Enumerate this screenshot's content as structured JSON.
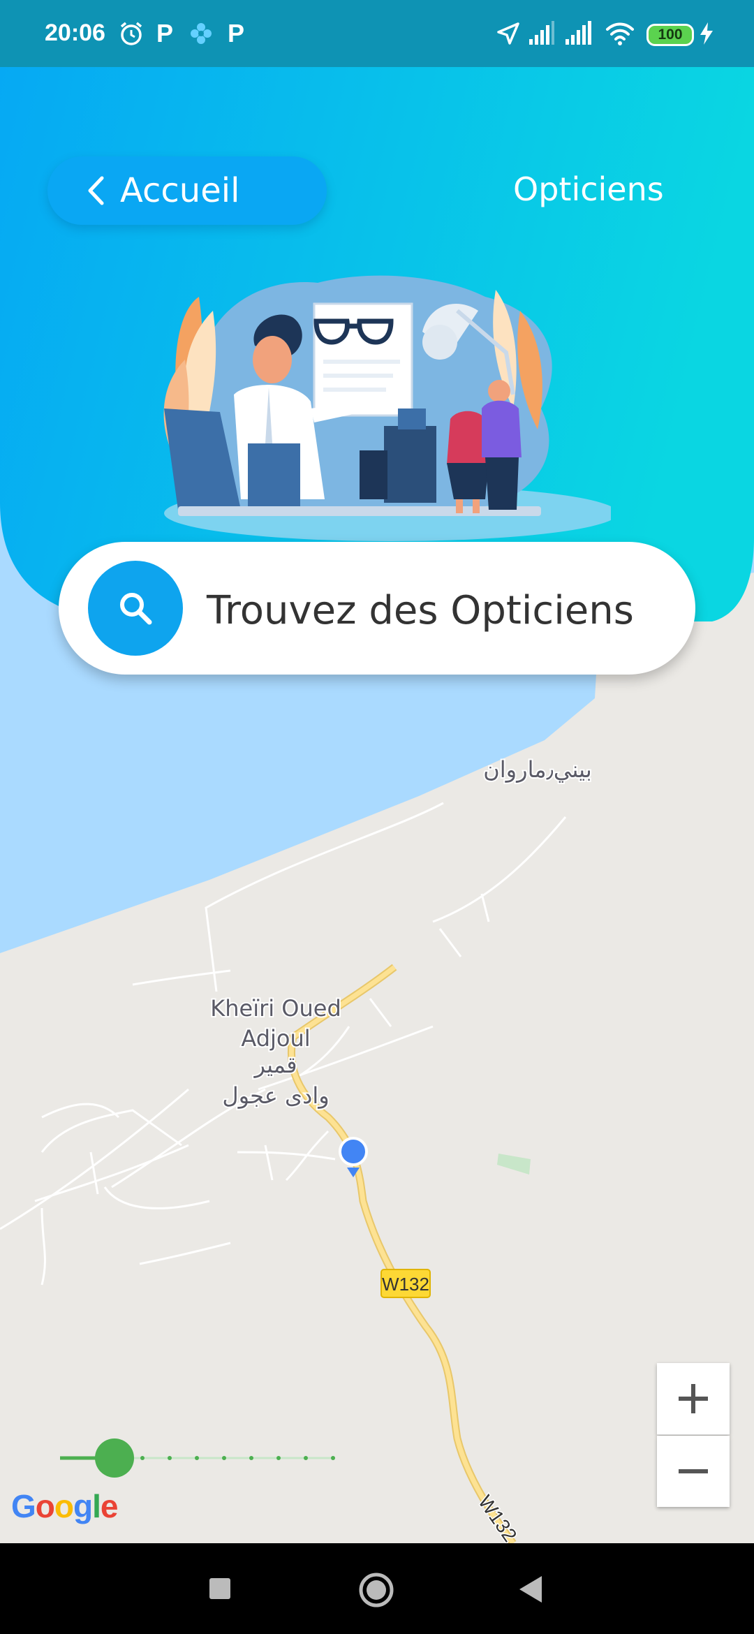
{
  "status_bar": {
    "time": "20:06",
    "icons": [
      "alarm-icon",
      "p-app-icon",
      "flower-app-icon",
      "p-app-icon",
      "location-arrow-icon",
      "signal-icon",
      "signal-icon",
      "wifi-icon",
      "battery-icon",
      "charging-icon"
    ],
    "battery_level": "100"
  },
  "header": {
    "back_label": "Accueil",
    "title": "Opticiens"
  },
  "search": {
    "placeholder": "Trouvez des Opticiens"
  },
  "map": {
    "labels": {
      "town_arabic_top": "بيني٫ماروان",
      "town_line1": "Kheïri Oued",
      "town_line2": "Adjoul",
      "town_arabic1": "قمير",
      "town_arabic2": "وادى عجول",
      "road1": "W132",
      "road2": "W132"
    },
    "zoom_in": "+",
    "zoom_out": "−",
    "attribution": "Google"
  },
  "colors": {
    "header_gradient_start": "#06a8f4",
    "header_gradient_end": "#0ad6e2",
    "sea": "#aadaff",
    "land": "#ebe9e5",
    "road": "#fde293",
    "location_dot": "#4285f4",
    "slider": "#4caf50"
  },
  "slider": {
    "value": 0.2
  }
}
